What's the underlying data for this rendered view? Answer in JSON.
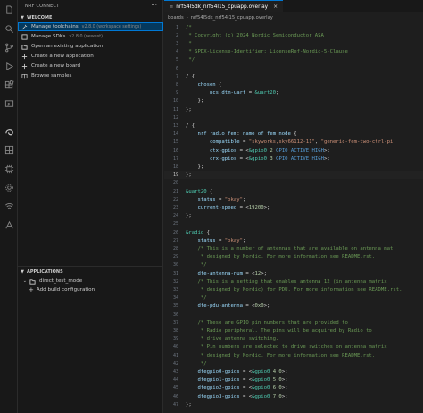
{
  "sidebar": {
    "title": "NRF CONNECT",
    "welcome_section": "WELCOME",
    "welcome_items": [
      {
        "label": "Manage toolchains",
        "version": "v2.8.0 (workspace settings)",
        "icon": "tools-icon"
      },
      {
        "label": "Manage SDKs",
        "version": "v2.8.0 (newest)",
        "icon": "sdk-icon"
      },
      {
        "label": "Open an existing application",
        "version": "",
        "icon": "folder-icon"
      },
      {
        "label": "Create a new application",
        "version": "",
        "icon": "plus-icon"
      },
      {
        "label": "Create a new board",
        "version": "",
        "icon": "plus-icon"
      },
      {
        "label": "Browse samples",
        "version": "",
        "icon": "book-icon"
      }
    ],
    "applications_section": "APPLICATIONS",
    "application_name": "direct_test_mode",
    "add_build": "Add build configuration"
  },
  "editor": {
    "tab_title": "nrf54l5dk_nrf54l15_cpuapp.overlay",
    "breadcrumbs": [
      "boards",
      "nrf54l5dk_nrf54l15_cpuapp.overlay"
    ],
    "current_line": 19,
    "lines": [
      {
        "n": "1",
        "segs": [
          [
            "c-com",
            "/*"
          ]
        ]
      },
      {
        "n": "2",
        "segs": [
          [
            "c-com",
            " * Copyright (c) 2024 Nordic Semiconductor ASA"
          ]
        ]
      },
      {
        "n": "3",
        "segs": [
          [
            "c-com",
            " *"
          ]
        ]
      },
      {
        "n": "4",
        "segs": [
          [
            "c-com",
            " * SPDX-License-Identifier: LicenseRef-Nordic-5-Clause"
          ]
        ]
      },
      {
        "n": "5",
        "segs": [
          [
            "c-com",
            " */"
          ]
        ]
      },
      {
        "n": "6",
        "segs": []
      },
      {
        "n": "7",
        "segs": [
          [
            "c-txt",
            "/ {"
          ]
        ]
      },
      {
        "n": "8",
        "segs": [
          [
            "c-prop",
            "    chosen"
          ],
          [
            "c-txt",
            " {"
          ]
        ]
      },
      {
        "n": "9",
        "segs": [
          [
            "c-prop",
            "        ncs,dtm-uart"
          ],
          [
            "c-txt",
            " = "
          ],
          [
            "c-lbl",
            "&uart20"
          ],
          [
            "c-txt",
            ";"
          ]
        ]
      },
      {
        "n": "10",
        "segs": [
          [
            "c-txt",
            "    };"
          ]
        ]
      },
      {
        "n": "11",
        "segs": [
          [
            "c-txt",
            "};"
          ]
        ]
      },
      {
        "n": "12",
        "segs": []
      },
      {
        "n": "13",
        "segs": [
          [
            "c-txt",
            "/ {"
          ]
        ]
      },
      {
        "n": "14",
        "segs": [
          [
            "c-prop",
            "    nrf_radio_fem"
          ],
          [
            "c-txt",
            ": "
          ],
          [
            "c-prop",
            "name_of_fem_node"
          ],
          [
            "c-txt",
            " {"
          ]
        ]
      },
      {
        "n": "15",
        "segs": [
          [
            "c-prop",
            "        compatible"
          ],
          [
            "c-txt",
            " = "
          ],
          [
            "c-str",
            "\"skyworks,sky66112-11\""
          ],
          [
            "c-txt",
            ", "
          ],
          [
            "c-str",
            "\"generic-fem-two-ctrl-pi"
          ]
        ]
      },
      {
        "n": "16",
        "segs": [
          [
            "c-prop",
            "        ctx-gpios"
          ],
          [
            "c-txt",
            " = <"
          ],
          [
            "c-lbl",
            "&gpio0"
          ],
          [
            "c-num",
            " 2 "
          ],
          [
            "c-kw",
            "GPIO_ACTIVE_HIGH"
          ],
          [
            "c-txt",
            ">;"
          ]
        ]
      },
      {
        "n": "17",
        "segs": [
          [
            "c-prop",
            "        crx-gpios"
          ],
          [
            "c-txt",
            " = <"
          ],
          [
            "c-lbl",
            "&gpio0"
          ],
          [
            "c-num",
            " 3 "
          ],
          [
            "c-kw",
            "GPIO_ACTIVE_HIGH"
          ],
          [
            "c-txt",
            ">;"
          ]
        ]
      },
      {
        "n": "18",
        "segs": [
          [
            "c-txt",
            "    };"
          ]
        ]
      },
      {
        "n": "19",
        "segs": [
          [
            "c-txt",
            "};"
          ]
        ]
      },
      {
        "n": "20",
        "segs": []
      },
      {
        "n": "21",
        "segs": [
          [
            "c-lbl",
            "&uart20"
          ],
          [
            "c-txt",
            " {"
          ]
        ]
      },
      {
        "n": "22",
        "segs": [
          [
            "c-prop",
            "    status"
          ],
          [
            "c-txt",
            " = "
          ],
          [
            "c-str",
            "\"okay\""
          ],
          [
            "c-txt",
            ";"
          ]
        ]
      },
      {
        "n": "23",
        "segs": [
          [
            "c-prop",
            "    current-speed"
          ],
          [
            "c-txt",
            " = <"
          ],
          [
            "c-num",
            "19200"
          ],
          [
            "c-txt",
            ">;"
          ]
        ]
      },
      {
        "n": "24",
        "segs": [
          [
            "c-txt",
            "};"
          ]
        ]
      },
      {
        "n": "25",
        "segs": []
      },
      {
        "n": "26",
        "segs": [
          [
            "c-lbl",
            "&radio"
          ],
          [
            "c-txt",
            " {"
          ]
        ]
      },
      {
        "n": "27",
        "segs": [
          [
            "c-prop",
            "    status"
          ],
          [
            "c-txt",
            " = "
          ],
          [
            "c-str",
            "\"okay\""
          ],
          [
            "c-txt",
            ";"
          ]
        ]
      },
      {
        "n": "28",
        "segs": [
          [
            "c-com",
            "    /* This is a number of antennas that are available on antenna mat"
          ]
        ]
      },
      {
        "n": "29",
        "segs": [
          [
            "c-com",
            "     * designed by Nordic. For more information see README.rst."
          ]
        ]
      },
      {
        "n": "30",
        "segs": [
          [
            "c-com",
            "     */"
          ]
        ]
      },
      {
        "n": "31",
        "segs": [
          [
            "c-prop",
            "    dfe-antenna-num"
          ],
          [
            "c-txt",
            " = <"
          ],
          [
            "c-num",
            "12"
          ],
          [
            "c-txt",
            ">;"
          ]
        ]
      },
      {
        "n": "32",
        "segs": [
          [
            "c-com",
            "    /* This is a setting that enables antenna 12 (in antenna matrix"
          ]
        ]
      },
      {
        "n": "33",
        "segs": [
          [
            "c-com",
            "     * designed by Nordic) for PDU. For more information see README.rst."
          ]
        ]
      },
      {
        "n": "34",
        "segs": [
          [
            "c-com",
            "     */"
          ]
        ]
      },
      {
        "n": "35",
        "segs": [
          [
            "c-prop",
            "    dfe-pdu-antenna"
          ],
          [
            "c-txt",
            " = <"
          ],
          [
            "c-num",
            "0x0"
          ],
          [
            "c-txt",
            ">;"
          ]
        ]
      },
      {
        "n": "36",
        "segs": []
      },
      {
        "n": "37",
        "segs": [
          [
            "c-com",
            "    /* These are GPIO pin numbers that are provided to"
          ]
        ]
      },
      {
        "n": "38",
        "segs": [
          [
            "c-com",
            "     * Radio peripheral. The pins will be acquired by Radio to"
          ]
        ]
      },
      {
        "n": "39",
        "segs": [
          [
            "c-com",
            "     * drive antenna switching."
          ]
        ]
      },
      {
        "n": "40",
        "segs": [
          [
            "c-com",
            "     * Pin numbers are selected to drive switches on antenna matrix"
          ]
        ]
      },
      {
        "n": "41",
        "segs": [
          [
            "c-com",
            "     * designed by Nordic. For more information see README.rst."
          ]
        ]
      },
      {
        "n": "42",
        "segs": [
          [
            "c-com",
            "     */"
          ]
        ]
      },
      {
        "n": "43",
        "segs": [
          [
            "c-prop",
            "    dfegpio0-gpios"
          ],
          [
            "c-txt",
            " = <"
          ],
          [
            "c-lbl",
            "&gpio0"
          ],
          [
            "c-num",
            " 4 0"
          ],
          [
            "c-txt",
            ">;"
          ]
        ]
      },
      {
        "n": "44",
        "segs": [
          [
            "c-prop",
            "    dfegpio1-gpios"
          ],
          [
            "c-txt",
            " = <"
          ],
          [
            "c-lbl",
            "&gpio0"
          ],
          [
            "c-num",
            " 5 0"
          ],
          [
            "c-txt",
            ">;"
          ]
        ]
      },
      {
        "n": "45",
        "segs": [
          [
            "c-prop",
            "    dfegpio2-gpios"
          ],
          [
            "c-txt",
            " = <"
          ],
          [
            "c-lbl",
            "&gpio0"
          ],
          [
            "c-num",
            " 6 0"
          ],
          [
            "c-txt",
            ">;"
          ]
        ]
      },
      {
        "n": "46",
        "segs": [
          [
            "c-prop",
            "    dfegpio3-gpios"
          ],
          [
            "c-txt",
            " = <"
          ],
          [
            "c-lbl",
            "&gpio0"
          ],
          [
            "c-num",
            " 7 0"
          ],
          [
            "c-txt",
            ">;"
          ]
        ]
      },
      {
        "n": "47",
        "segs": [
          [
            "c-txt",
            "};"
          ]
        ]
      }
    ]
  },
  "activity_icons": [
    "explorer-icon",
    "search-icon",
    "source-control-icon",
    "run-debug-icon",
    "extensions-icon",
    "remote-icon",
    "nrf-connect-icon",
    "devicetree-icon",
    "memory-icon",
    "settings-icon",
    "wifi-icon",
    "terminal-icon"
  ]
}
